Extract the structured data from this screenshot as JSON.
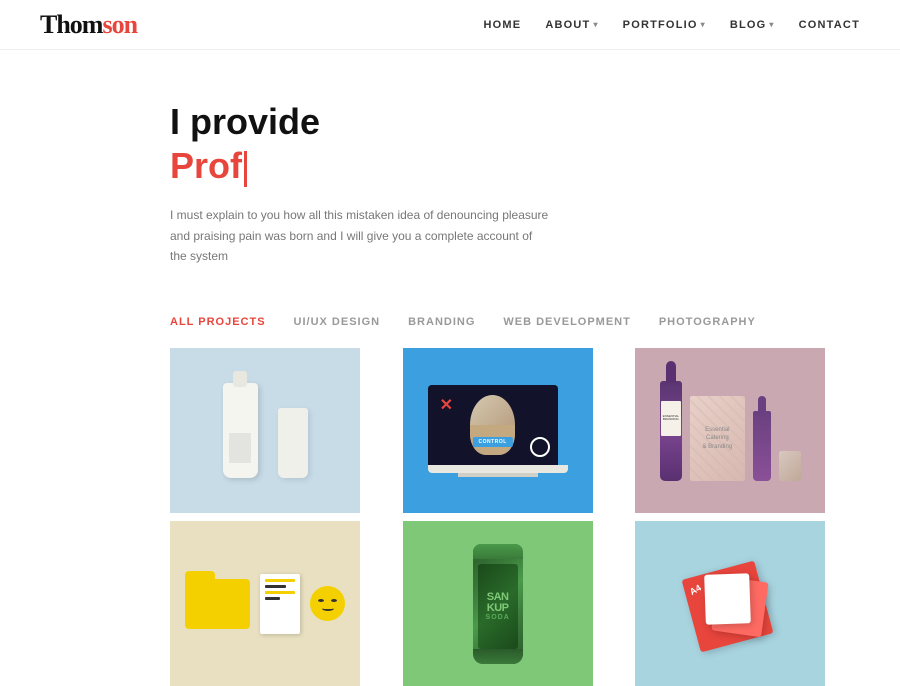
{
  "header": {
    "logo_text": "Thomson",
    "logo_accent": "son",
    "nav": [
      {
        "label": "HOME",
        "hasDropdown": false
      },
      {
        "label": "ABOUT",
        "hasDropdown": true
      },
      {
        "label": "PORTFOLIO",
        "hasDropdown": true
      },
      {
        "label": "BLOG",
        "hasDropdown": true
      },
      {
        "label": "CONTACT",
        "hasDropdown": false
      }
    ]
  },
  "hero": {
    "title": "I provide",
    "typed_text": "Prof",
    "description": "I must explain to you how all this mistaken idea of denouncing pleasure and praising pain was born and I will give you a complete account of the system"
  },
  "portfolio": {
    "filter_items": [
      {
        "label": "ALL PROJECTS",
        "active": true
      },
      {
        "label": "UI/UX DESIGN",
        "active": false
      },
      {
        "label": "BRANDING",
        "active": false
      },
      {
        "label": "WEB DEVELOPMENT",
        "active": false
      },
      {
        "label": "PHOTOGRAPHY",
        "active": false
      }
    ],
    "grid_items": [
      {
        "id": "item-1",
        "category": "branding",
        "bg": "#c8dce8"
      },
      {
        "id": "item-2",
        "category": "uiux",
        "bg": "#3b9fe0"
      },
      {
        "id": "item-3",
        "category": "branding",
        "bg": "#c9a8b2"
      },
      {
        "id": "item-4",
        "category": "branding",
        "bg": "#e8e0c0"
      },
      {
        "id": "item-5",
        "category": "photography",
        "bg": "#7ec878"
      },
      {
        "id": "item-6",
        "category": "photography",
        "bg": "#a8d4e0"
      }
    ]
  },
  "colors": {
    "accent": "#e8453c",
    "text_dark": "#111111",
    "text_muted": "#777777",
    "nav_text": "#333333"
  }
}
